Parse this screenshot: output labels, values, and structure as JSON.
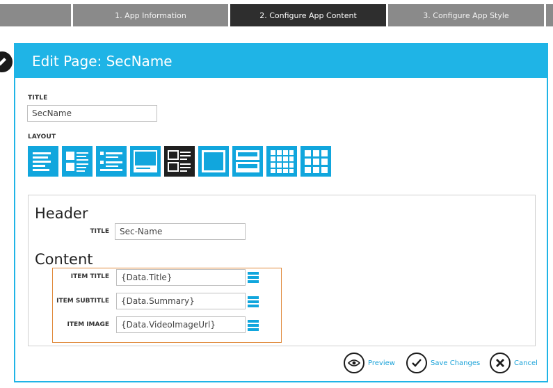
{
  "wizard": {
    "steps": [
      {
        "label": ""
      },
      {
        "label": "1. App Information"
      },
      {
        "label": "2. Configure App Content"
      },
      {
        "label": "3. Configure App Style"
      },
      {
        "label": ""
      }
    ]
  },
  "panel": {
    "title": "Edit Page: SecName",
    "title_label": "TITLE",
    "title_value": "SecName",
    "layout_label": "LAYOUT",
    "layouts": [
      {
        "icon": "layout-list-icon"
      },
      {
        "icon": "layout-thumbnail-list-icon"
      },
      {
        "icon": "layout-bullet-list-icon"
      },
      {
        "icon": "layout-image-caption-icon"
      },
      {
        "icon": "layout-two-row-thumbnails-icon",
        "selected": true
      },
      {
        "icon": "layout-full-image-icon"
      },
      {
        "icon": "layout-stacked-images-icon"
      },
      {
        "icon": "layout-grid-4x4-icon"
      },
      {
        "icon": "layout-grid-3x3-icon"
      }
    ]
  },
  "header_section": {
    "heading": "Header",
    "title_label": "TITLE",
    "title_value": "Sec-Name"
  },
  "content_section": {
    "heading": "Content",
    "item_title_label": "ITEM TITLE",
    "item_title_value": "{Data.Title}",
    "item_subtitle_label": "ITEM SUBTITLE",
    "item_subtitle_value": "{Data.Summary}",
    "item_image_label": "ITEM IMAGE",
    "item_image_value": "{Data.VideoImageUrl}"
  },
  "actions": {
    "preview": "Preview",
    "save": "Save Changes",
    "cancel": "Cancel"
  },
  "colors": {
    "accent": "#1fb4e6",
    "tile": "#11a6dd",
    "selected_tile": "#1f1f1f",
    "highlight": "#e08a3c",
    "link": "#1aa2d8"
  }
}
